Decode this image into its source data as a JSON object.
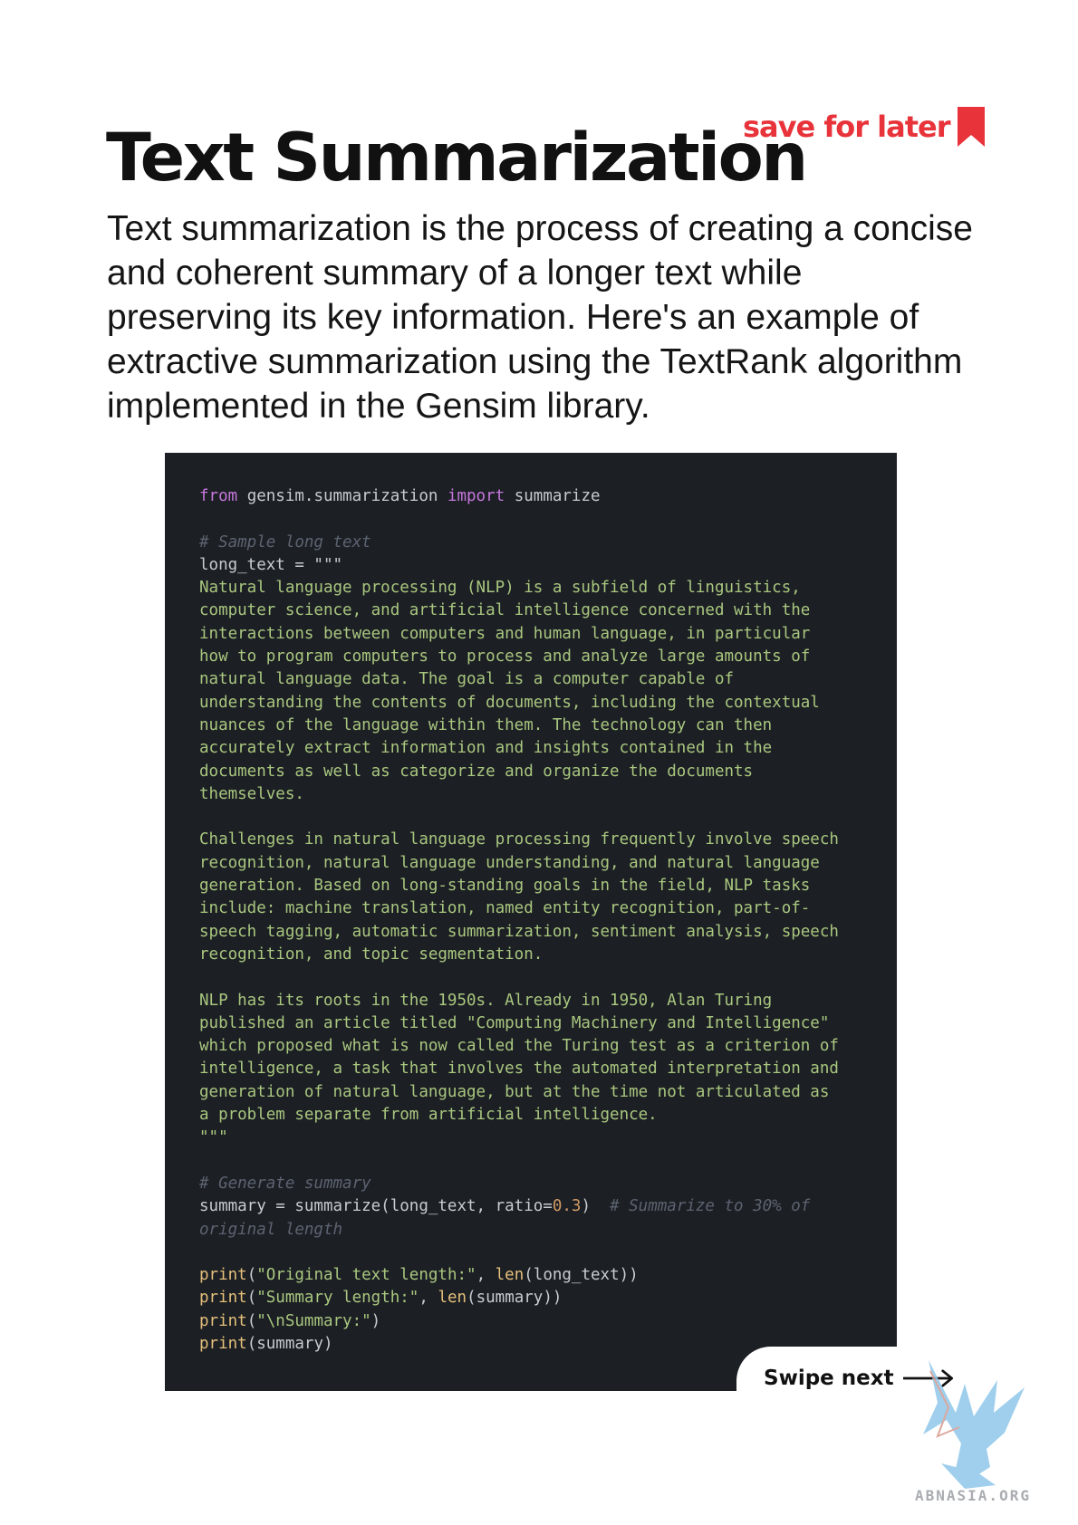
{
  "header": {
    "title": "Text Summarization",
    "save_label": "save for later",
    "accent_color": "#e8333a"
  },
  "intro": {
    "text": "Text summarization is the process of creating a concise and coherent summary of a longer text while preserving its key information. Here's an example of extractive summarization using the TextRank algorithm implemented in the Gensim library."
  },
  "code": {
    "background": "#1c1f24",
    "lines": {
      "import_from": "from",
      "import_module": " gensim.summarization ",
      "import_kw": "import",
      "import_name": " summarize",
      "comment_sample": "# Sample long text",
      "long_text_assign": "long_text = \"\"\"",
      "p1_l1": "Natural language processing (NLP) is a subfield of linguistics,",
      "p1_l2": "computer science, and artificial intelligence concerned with the",
      "p1_l3": "interactions between computers and human language, in particular",
      "p1_l4": "how to program computers to process and analyze large amounts of",
      "p1_l5": "natural language data. The goal is a computer capable of",
      "p1_l6": "understanding the contents of documents, including the contextual",
      "p1_l7": "nuances of the language within them. The technology can then",
      "p1_l8": "accurately extract information and insights contained in the",
      "p1_l9": "documents as well as categorize and organize the documents",
      "p1_l10": "themselves.",
      "p2_l1": "Challenges in natural language processing frequently involve speech",
      "p2_l2": "recognition, natural language understanding, and natural language",
      "p2_l3": "generation. Based on long-standing goals in the field, NLP tasks",
      "p2_l4": "include: machine translation, named entity recognition, part-of-",
      "p2_l5": "speech tagging, automatic summarization, sentiment analysis, speech",
      "p2_l6": "recognition, and topic segmentation.",
      "p3_l1": "NLP has its roots in the 1950s. Already in 1950, Alan Turing",
      "p3_l2": "published an article titled \"Computing Machinery and Intelligence\"",
      "p3_l3": "which proposed what is now called the Turing test as a criterion of",
      "p3_l4": "intelligence, a task that involves the automated interpretation and",
      "p3_l5": "generation of natural language, but at the time not articulated as",
      "p3_l6": "a problem separate from artificial intelligence.",
      "string_close": "\"\"\"",
      "comment_generate": "# Generate summary",
      "summary_assign": "summary = summarize(long_text, ratio=",
      "ratio_value": "0.3",
      "summary_close": ")",
      "comment_ratio_a": "# Summarize to 30% of",
      "comment_ratio_b": "original length",
      "print_fn": "print",
      "len_fn": "len",
      "print1_str": "\"Original text length:\"",
      "print1_args": "(long_text))",
      "print2_str": "\"Summary length:\"",
      "print2_args": "(summary))",
      "print3_str": "\"\\nSummary:\"",
      "print4_args": "(summary)"
    }
  },
  "footer": {
    "swipe_label": "Swipe next",
    "watermark_text": "ABNASIA.ORG"
  }
}
